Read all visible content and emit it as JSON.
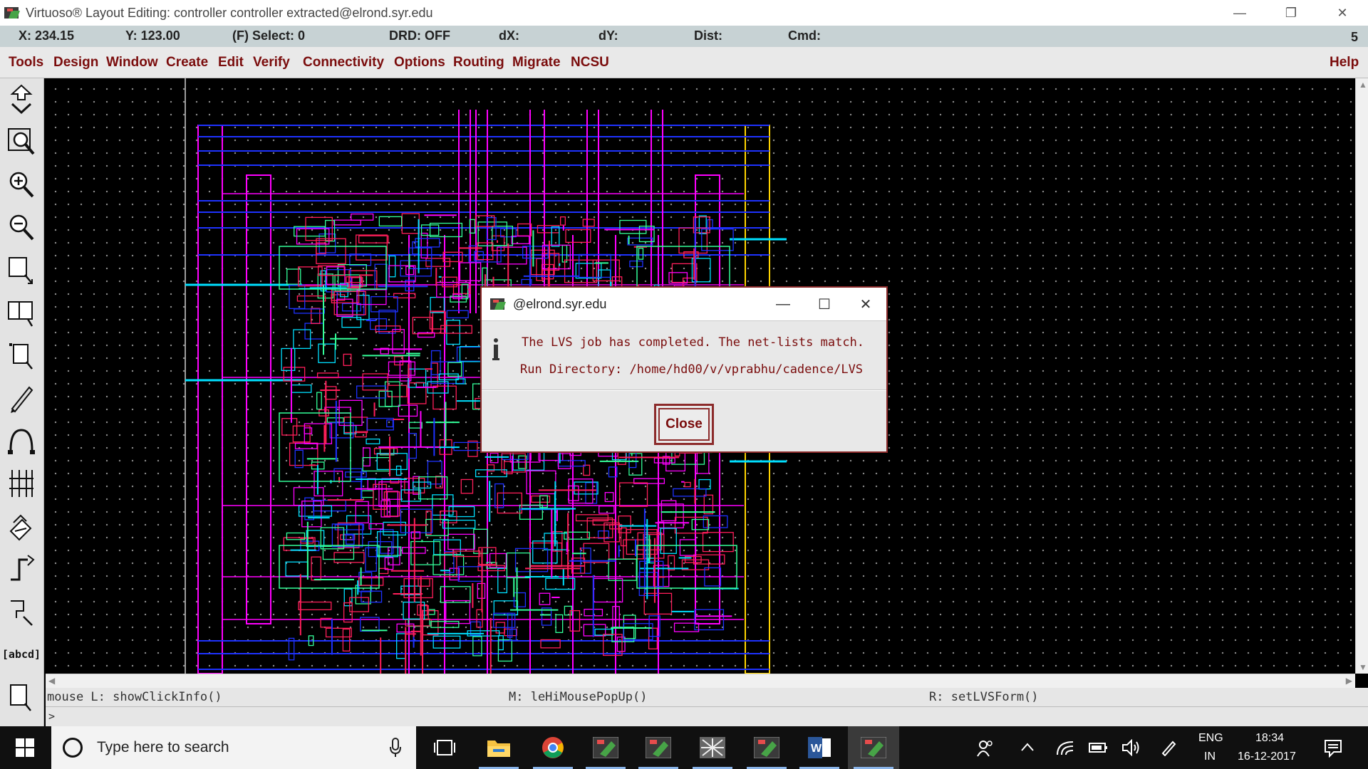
{
  "window": {
    "title": "Virtuoso® Layout Editing: controller controller extracted@elrond.syr.edu",
    "controls": {
      "minimize": "—",
      "restore": "❐",
      "close": "✕"
    }
  },
  "status": {
    "x": "X: 234.15",
    "y": "Y: 123.00",
    "select": "(F) Select: 0",
    "drd": "DRD: OFF",
    "dx": "dX:",
    "dy": "dY:",
    "dist": "Dist:",
    "cmd": "Cmd:",
    "count": "5"
  },
  "menu": {
    "items": [
      "Tools",
      "Design",
      "Window",
      "Create",
      "Edit",
      "Verify",
      "Connectivity",
      "Options",
      "Routing",
      "Migrate",
      "NCSU"
    ],
    "help": "Help"
  },
  "toolbar": {
    "tools": [
      "save-tool",
      "zoom-fit-tool",
      "zoom-in-tool",
      "zoom-out-tool",
      "stretch-tool",
      "copy-tool",
      "move-tool",
      "delete-tool",
      "undo-tool",
      "properties-tool",
      "instance-tool",
      "path-tool",
      "polygon-tool",
      "label-tool",
      "rectangle-tool"
    ],
    "label_tool_text": "[abcd]"
  },
  "mouse_bindings": {
    "left": "mouse L: showClickInfo()",
    "middle": "M: leHiMousePopUp()",
    "right": "R: setLVSForm()"
  },
  "command_prompt": ">",
  "dialog": {
    "title": "@elrond.syr.edu",
    "message_line1": "The LVS job has completed. The net-lists match.",
    "message_line2": "Run Directory: /home/hd00/v/vprabhu/cadence/LVS",
    "close_label": "Close",
    "controls": {
      "minimize": "—",
      "maximize": "☐",
      "close": "✕"
    }
  },
  "taskbar": {
    "search_placeholder": "Type here to search",
    "apps": [
      "task-view",
      "file-explorer",
      "chrome",
      "virtuoso-1",
      "virtuoso-2",
      "virtuoso-3",
      "virtuoso-4",
      "word",
      "virtuoso-active"
    ],
    "lang_top": "ENG",
    "lang_bottom": "IN",
    "time": "18:34",
    "date": "16-12-2017"
  },
  "colors": {
    "menu_text": "#7a0c0c",
    "status_bg": "#c7d2d4",
    "metal1": "#1e32ff",
    "poly": "#ff1e5a",
    "metal2": "#ff00ff",
    "active": "#33ff99",
    "via": "#00e0ff",
    "boundary": "#ffd400"
  }
}
